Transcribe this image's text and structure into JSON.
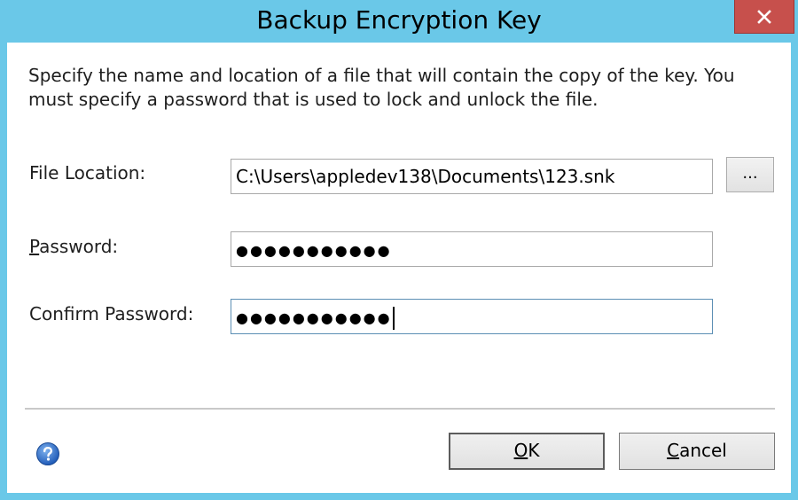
{
  "window": {
    "title": "Backup Encryption Key",
    "close_icon": "close-icon"
  },
  "description": "Specify the name and location of a file that will contain the copy of the key.  You must specify a password that is used to lock and unlock the file.",
  "fields": {
    "file_location": {
      "label": "File Location:",
      "value": "C:\\Users\\appledev138\\Documents\\123.snk",
      "browse_label": "..."
    },
    "password": {
      "label_mnemonic": "P",
      "label_rest": "assword:",
      "masked_value": "●●●●●●●●●●●"
    },
    "confirm_password": {
      "label": "Confirm Password:",
      "masked_value": "●●●●●●●●●●●"
    }
  },
  "footer": {
    "help_icon": "help-icon",
    "ok_mnemonic": "O",
    "ok_rest": "K",
    "cancel_mnemonic": "C",
    "cancel_rest": "ancel"
  },
  "colors": {
    "frame": "#6ac8e8",
    "close_button": "#c7504c",
    "focus_border": "#5c8fb4"
  }
}
